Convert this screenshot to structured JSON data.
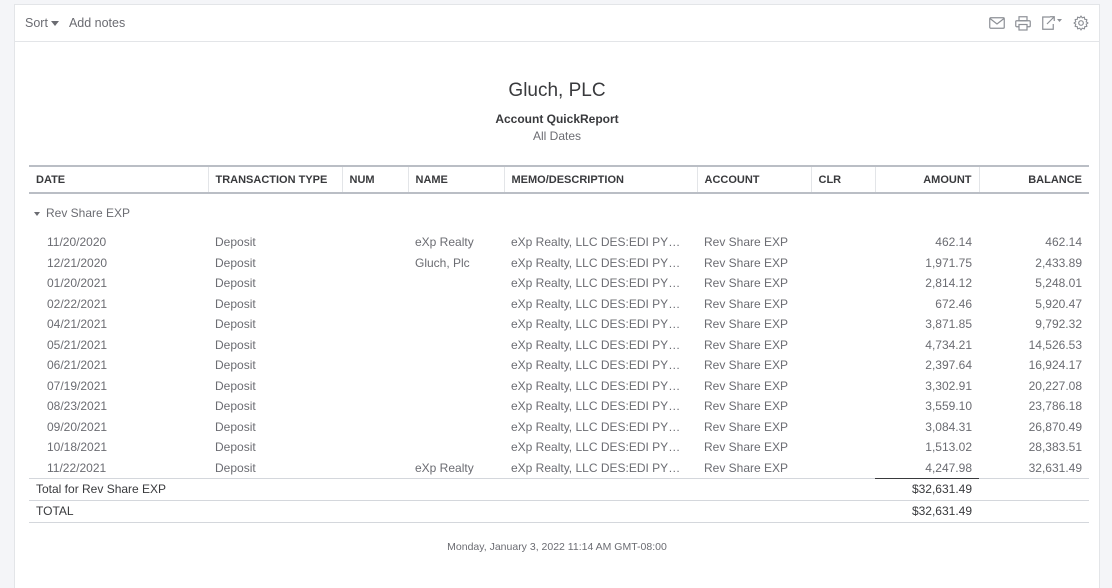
{
  "toolbar": {
    "sort_label": "Sort",
    "add_notes_label": "Add notes",
    "icons": [
      "email-icon",
      "print-icon",
      "export-icon",
      "settings-icon"
    ]
  },
  "report": {
    "company": "Gluch, PLC",
    "title": "Account QuickReport",
    "subtitle": "All Dates"
  },
  "table": {
    "columns": [
      "DATE",
      "TRANSACTION TYPE",
      "NUM",
      "NAME",
      "MEMO/DESCRIPTION",
      "ACCOUNT",
      "CLR",
      "AMOUNT",
      "BALANCE"
    ],
    "group_label": "Rev Share EXP",
    "rows": [
      {
        "date": "11/20/2020",
        "type": "Deposit",
        "num": "",
        "name": "eXp Realty",
        "memo": "eXp Realty, LLC DES:EDI PYMNT...",
        "account": "Rev Share EXP",
        "clr": "",
        "amount": "462.14",
        "balance": "462.14"
      },
      {
        "date": "12/21/2020",
        "type": "Deposit",
        "num": "",
        "name": "Gluch, Plc",
        "memo": "eXp Realty, LLC DES:EDI PYMNT...",
        "account": "Rev Share EXP",
        "clr": "",
        "amount": "1,971.75",
        "balance": "2,433.89"
      },
      {
        "date": "01/20/2021",
        "type": "Deposit",
        "num": "",
        "name": "",
        "memo": "eXp Realty, LLC DES:EDI PYMNT...",
        "account": "Rev Share EXP",
        "clr": "",
        "amount": "2,814.12",
        "balance": "5,248.01"
      },
      {
        "date": "02/22/2021",
        "type": "Deposit",
        "num": "",
        "name": "",
        "memo": "eXp Realty, LLC DES:EDI PYMNT...",
        "account": "Rev Share EXP",
        "clr": "",
        "amount": "672.46",
        "balance": "5,920.47"
      },
      {
        "date": "04/21/2021",
        "type": "Deposit",
        "num": "",
        "name": "",
        "memo": "eXp Realty, LLC DES:EDI PYMNT...",
        "account": "Rev Share EXP",
        "clr": "",
        "amount": "3,871.85",
        "balance": "9,792.32"
      },
      {
        "date": "05/21/2021",
        "type": "Deposit",
        "num": "",
        "name": "",
        "memo": "eXp Realty, LLC DES:EDI PYMNT...",
        "account": "Rev Share EXP",
        "clr": "",
        "amount": "4,734.21",
        "balance": "14,526.53"
      },
      {
        "date": "06/21/2021",
        "type": "Deposit",
        "num": "",
        "name": "",
        "memo": "eXp Realty, LLC DES:EDI PYMNT...",
        "account": "Rev Share EXP",
        "clr": "",
        "amount": "2,397.64",
        "balance": "16,924.17"
      },
      {
        "date": "07/19/2021",
        "type": "Deposit",
        "num": "",
        "name": "",
        "memo": "eXp Realty, LLC DES:EDI PYMNT...",
        "account": "Rev Share EXP",
        "clr": "",
        "amount": "3,302.91",
        "balance": "20,227.08"
      },
      {
        "date": "08/23/2021",
        "type": "Deposit",
        "num": "",
        "name": "",
        "memo": "eXp Realty, LLC DES:EDI PYMNT...",
        "account": "Rev Share EXP",
        "clr": "",
        "amount": "3,559.10",
        "balance": "23,786.18"
      },
      {
        "date": "09/20/2021",
        "type": "Deposit",
        "num": "",
        "name": "",
        "memo": "eXp Realty, LLC DES:EDI PYMNT...",
        "account": "Rev Share EXP",
        "clr": "",
        "amount": "3,084.31",
        "balance": "26,870.49"
      },
      {
        "date": "10/18/2021",
        "type": "Deposit",
        "num": "",
        "name": "",
        "memo": "eXp Realty, LLC DES:EDI PYMNT...",
        "account": "Rev Share EXP",
        "clr": "",
        "amount": "1,513.02",
        "balance": "28,383.51"
      },
      {
        "date": "11/22/2021",
        "type": "Deposit",
        "num": "",
        "name": "eXp Realty",
        "memo": "eXp Realty, LLC DES:EDI PYMNT...",
        "account": "Rev Share EXP",
        "clr": "",
        "amount": "4,247.98",
        "balance": "32,631.49"
      }
    ],
    "subtotal": {
      "label": "Total for Rev Share EXP",
      "amount": "$32,631.49"
    },
    "total": {
      "label": "TOTAL",
      "amount": "$32,631.49"
    }
  },
  "footer": {
    "timestamp": "Monday, January 3, 2022   11:14 AM GMT-08:00"
  }
}
